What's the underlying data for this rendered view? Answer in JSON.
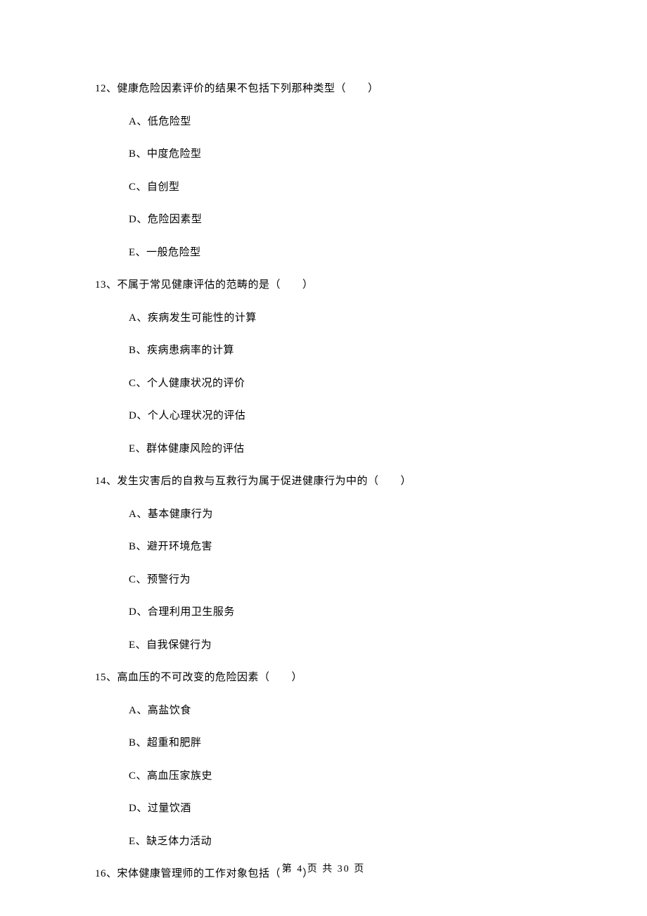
{
  "questions": [
    {
      "number": "12、",
      "text": "健康危险因素评价的结果不包括下列那种类型（　　）",
      "options": [
        "A、低危险型",
        "B、中度危险型",
        "C、自创型",
        "D、危险因素型",
        "E、一般危险型"
      ]
    },
    {
      "number": "13、",
      "text": "不属于常见健康评估的范畴的是（　　）",
      "options": [
        "A、疾病发生可能性的计算",
        "B、疾病患病率的计算",
        "C、个人健康状况的评价",
        "D、个人心理状况的评估",
        "E、群体健康风险的评估"
      ]
    },
    {
      "number": "14、",
      "text": "发生灾害后的自救与互救行为属于促进健康行为中的（　　）",
      "options": [
        "A、基本健康行为",
        "B、避开环境危害",
        "C、预警行为",
        "D、合理利用卫生服务",
        "E、自我保健行为"
      ]
    },
    {
      "number": "15、",
      "text": "高血压的不可改变的危险因素（　　）",
      "options": [
        "A、高盐饮食",
        "B、超重和肥胖",
        "C、高血压家族史",
        "D、过量饮酒",
        "E、缺乏体力活动"
      ]
    },
    {
      "number": "16、",
      "text": "宋体健康管理师的工作对象包括（　　）",
      "options": []
    }
  ],
  "footer": "第 4 页 共 30 页"
}
